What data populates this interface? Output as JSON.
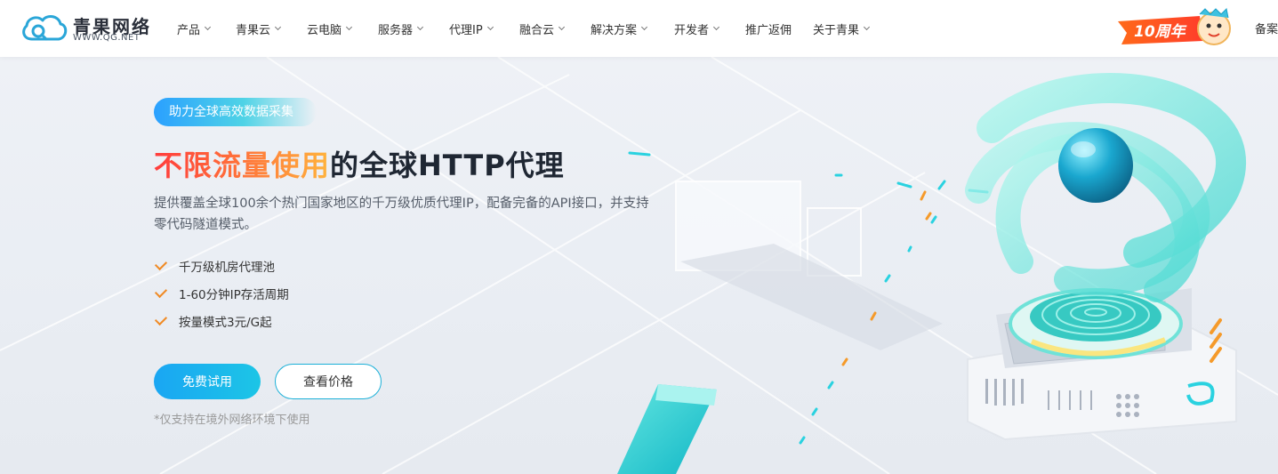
{
  "nav": {
    "logo": {
      "cn": "青果网络",
      "en": "WWW.QG.NET"
    },
    "items": [
      {
        "label": "产品",
        "has_dropdown": true
      },
      {
        "label": "青果云",
        "has_dropdown": true
      },
      {
        "label": "云电脑",
        "has_dropdown": true
      },
      {
        "label": "服务器",
        "has_dropdown": true
      },
      {
        "label": "代理IP",
        "has_dropdown": true
      },
      {
        "label": "融合云",
        "has_dropdown": true
      },
      {
        "label": "解决方案",
        "has_dropdown": true
      },
      {
        "label": "开发者",
        "has_dropdown": true
      },
      {
        "label": "推广返佣",
        "has_dropdown": false
      },
      {
        "label": "关于青果",
        "has_dropdown": true
      }
    ],
    "anniversary_badge": "10周年",
    "beian": "备案"
  },
  "hero": {
    "tag": "助力全球高效数据采集",
    "headline_accent": "不限流量使用",
    "headline_rest": "的全球HTTP代理",
    "description": "提供覆盖全球100余个热门国家地区的千万级优质代理IP，配备完备的API接口，并支持零代码隧道模式。",
    "features": [
      "千万级机房代理池",
      "1-60分钟IP存活周期",
      "按量模式3元/G起"
    ],
    "primary_button": "免费试用",
    "secondary_button": "查看价格",
    "note": "*仅支持在境外网络环境下使用"
  },
  "colors": {
    "accent_blue": "#1aa6f3",
    "accent_cyan": "#1cc5e6",
    "check_orange": "#f08a24",
    "headline_gradient": [
      "#ff3b3b",
      "#ffb43d"
    ]
  }
}
